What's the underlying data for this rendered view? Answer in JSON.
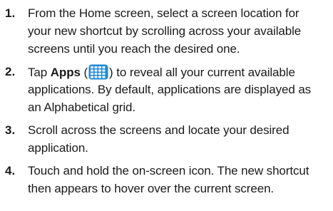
{
  "steps": [
    {
      "number": "1.",
      "lines": [
        "From the Home screen, select a screen location for",
        "your new shortcut by scrolling across your available",
        "screens until you reach the desired one."
      ]
    },
    {
      "number": "2.",
      "line1_prefix": "Tap ",
      "line1_bold": "Apps",
      "line1_open": " (",
      "line1_suffix": ") to reveal all your current available",
      "lines_rest": [
        "applications. By default, applications are displayed as",
        "an Alphabetical grid."
      ],
      "icon": "apps-grid-icon",
      "icon_color": "#1e88d8"
    },
    {
      "number": "3.",
      "lines": [
        "Scroll across the screens and locate your desired",
        "application."
      ]
    },
    {
      "number": "4.",
      "lines": [
        "Touch and hold the on-screen icon. The new shortcut",
        "then appears to hover over the current screen."
      ]
    }
  ]
}
